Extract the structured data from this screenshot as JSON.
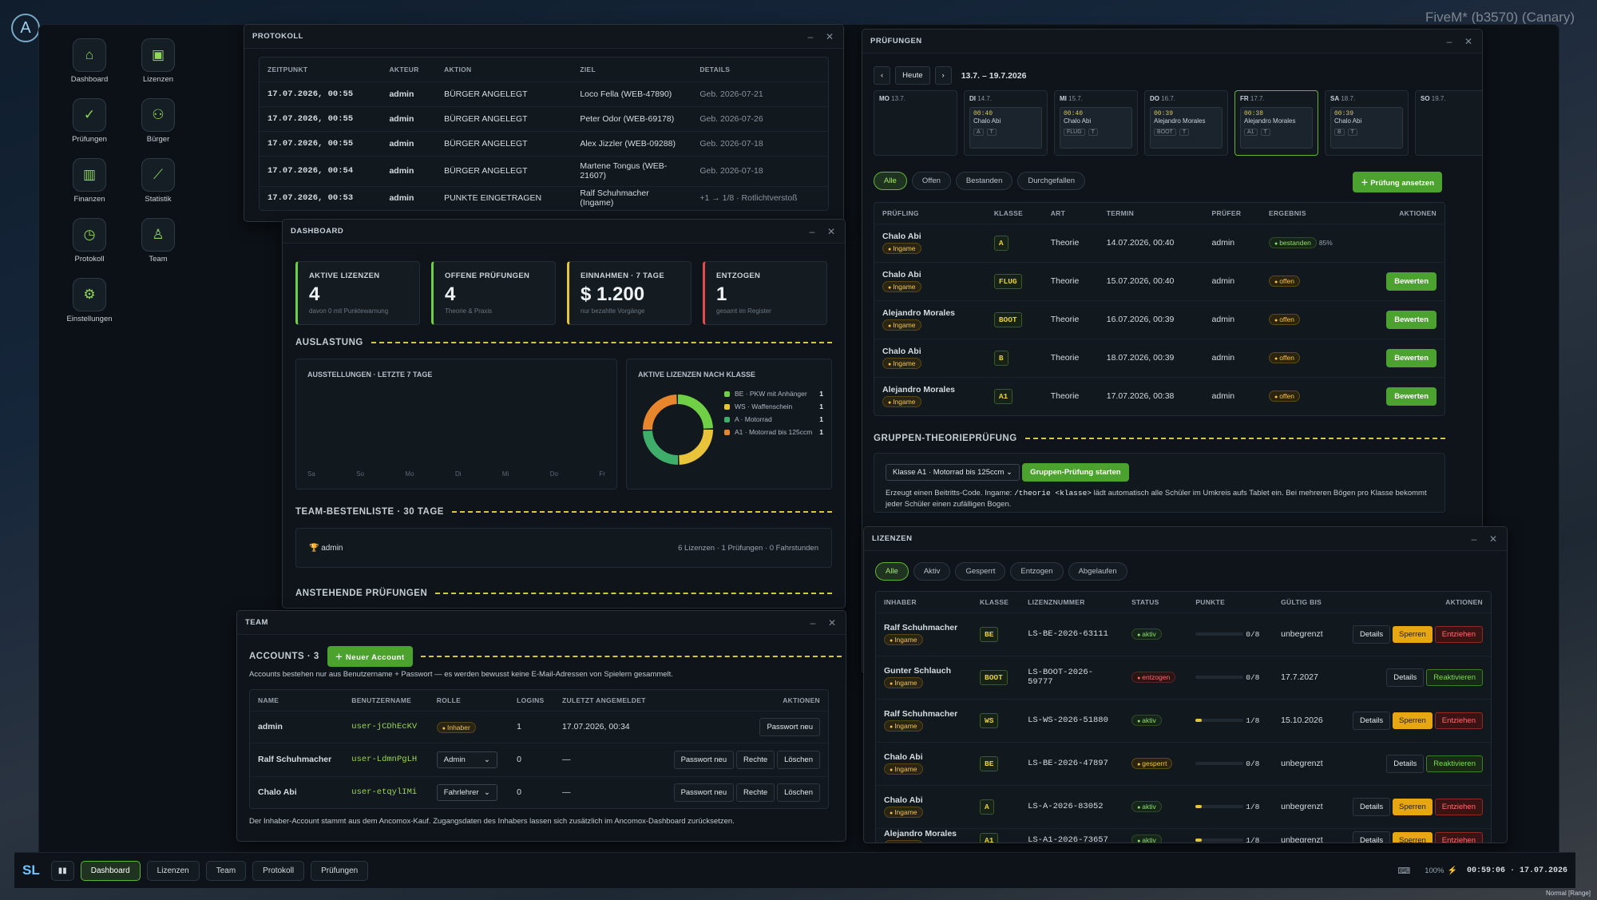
{
  "bg": {
    "server": "FiveM* (b3570) (Canary)"
  },
  "sidebar": {
    "logo": "A",
    "items": [
      {
        "label": "Dashboard",
        "icon": "⌂"
      },
      {
        "label": "Lizenzen",
        "icon": "▣"
      },
      {
        "label": "Prüfungen",
        "icon": "✓"
      },
      {
        "label": "Bürger",
        "icon": "⚇"
      },
      {
        "label": "Finanzen",
        "icon": "▥"
      },
      {
        "label": "Statistik",
        "icon": "⟋"
      },
      {
        "label": "Protokoll",
        "icon": "◷"
      },
      {
        "label": "Team",
        "icon": "♙"
      },
      {
        "label": "Einstellungen",
        "icon": "⚙"
      }
    ]
  },
  "protokoll": {
    "title": "PROTOKOLL",
    "headers": [
      "ZEITPUNKT",
      "AKTEUR",
      "AKTION",
      "ZIEL",
      "DETAILS"
    ],
    "rows": [
      [
        "17.07.2026, 00:55",
        "admin",
        "BÜRGER ANGELEGT",
        "Loco Fella (WEB-47890)",
        "Geb. 2026-07-21"
      ],
      [
        "17.07.2026, 00:55",
        "admin",
        "BÜRGER ANGELEGT",
        "Peter Odor (WEB-69178)",
        "Geb. 2026-07-26"
      ],
      [
        "17.07.2026, 00:55",
        "admin",
        "BÜRGER ANGELEGT",
        "Alex Jizzler (WEB-09288)",
        "Geb. 2026-07-18"
      ],
      [
        "17.07.2026, 00:54",
        "admin",
        "BÜRGER ANGELEGT",
        "Martene Tongus (WEB-21607)",
        "Geb. 2026-07-18"
      ],
      [
        "17.07.2026, 00:53",
        "admin",
        "PUNKTE EINGETRAGEN",
        "Ralf Schuhmacher (Ingame)",
        "+1 → 1/8 · Rotlichtverstoß"
      ]
    ]
  },
  "dashboard": {
    "title": "DASHBOARD",
    "kpis": [
      {
        "label": "AKTIVE LIZENZEN",
        "value": "4",
        "sub": "davon 0 mit Punktewarnung",
        "color": "#6fcf45"
      },
      {
        "label": "OFFENE PRÜFUNGEN",
        "value": "4",
        "sub": "Theorie & Praxis",
        "color": "#6fcf45"
      },
      {
        "label": "EINNAHMEN · 7 TAGE",
        "value": "$ 1.200",
        "sub": "nur bezahlte Vorgänge",
        "color": "#e3c43a"
      },
      {
        "label": "ENTZOGEN",
        "value": "1",
        "sub": "gesamt im Register",
        "color": "#e24b4b"
      }
    ],
    "auslastung": "AUSLASTUNG",
    "ausstellungen_title": "AUSSTELLUNGEN · LETZTE 7 TAGE",
    "days": [
      "Sa",
      "So",
      "Mo",
      "Di",
      "Mi",
      "Do",
      "Fr"
    ],
    "donut_title": "AKTIVE LIZENZEN NACH KLASSE",
    "chart_data": {
      "type": "pie",
      "title": "AKTIVE LIZENZEN NACH KLASSE",
      "categories": [
        "BE · PKW mit Anhänger",
        "WS · Waffenschein",
        "A · Motorrad",
        "A1 · Motorrad bis 125ccm"
      ],
      "values": [
        1,
        1,
        1,
        1
      ],
      "colors": [
        "#6fcf45",
        "#e9c43a",
        "#3fae6a",
        "#e8862e"
      ]
    },
    "bestenliste": "TEAM-BESTENLISTE · 30 TAGE",
    "best_name": "admin",
    "best_icon": "🏆",
    "best_stats": "6 Lizenzen · 1 Prüfungen · 0 Fahrstunden",
    "anstehend": "ANSTEHENDE PRÜFUNGEN"
  },
  "team": {
    "title": "TEAM",
    "accounts": "ACCOUNTS · 3",
    "new_btn": "＋ Neuer Account",
    "note": "Accounts bestehen nur aus Benutzername + Passwort — es werden bewusst keine E-Mail-Adressen von Spielern gesammelt.",
    "headers": [
      "NAME",
      "BENUTZERNAME",
      "ROLLE",
      "LOGINS",
      "ZULETZT ANGEMELDET",
      "AKTIONEN"
    ],
    "rows": [
      {
        "name": "admin",
        "user": "user-jCDhEcKV",
        "role": "Inhaber",
        "logins": "1",
        "last": "17.07.2026, 00:34"
      },
      {
        "name": "Ralf Schuhmacher",
        "user": "user-LdmnPgLH",
        "role": "Admin",
        "logins": "0",
        "last": "—"
      },
      {
        "name": "Chalo Abi",
        "user": "user-etqylIMi",
        "role": "Fahrlehrer",
        "logins": "0",
        "last": "—"
      }
    ],
    "pw": "Passwort neu",
    "rechte": "Rechte",
    "loeschen": "Löschen",
    "footer": "Der Inhaber-Account stammt aus dem Ancomox-Kauf. Zugangsdaten des Inhabers lassen sich zusätzlich im Ancomox-Dashboard zurücksetzen."
  },
  "pruefungen": {
    "title": "PRÜFUNGEN",
    "today": "Heute",
    "range": "13.7. – 19.7.2026",
    "days": [
      {
        "d": "MO",
        "n": "13.7.",
        "ev": null
      },
      {
        "d": "DI",
        "n": "14.7.",
        "ev": {
          "t": "00:40",
          "name": "Chalo Abi",
          "k": "A",
          "a": "T"
        }
      },
      {
        "d": "MI",
        "n": "15.7.",
        "ev": {
          "t": "00:40",
          "name": "Chalo Abi",
          "k": "FLUG",
          "a": "T"
        }
      },
      {
        "d": "DO",
        "n": "16.7.",
        "ev": {
          "t": "00:39",
          "name": "Alejandro Morales",
          "k": "BOOT",
          "a": "T"
        }
      },
      {
        "d": "FR",
        "n": "17.7.",
        "ev": {
          "t": "00:38",
          "name": "Alejandro Morales",
          "k": "A1",
          "a": "T"
        }
      },
      {
        "d": "SA",
        "n": "18.7.",
        "ev": {
          "t": "00:39",
          "name": "Chalo Abi",
          "k": "B",
          "a": "T"
        }
      },
      {
        "d": "SO",
        "n": "19.7.",
        "ev": null
      }
    ],
    "filters": [
      "Alle",
      "Offen",
      "Bestanden",
      "Durchgefallen"
    ],
    "new_btn": "＋ Prüfung ansetzen",
    "headers": [
      "PRÜFLING",
      "KLASSE",
      "ART",
      "TERMIN",
      "PRÜFER",
      "ERGEBNIS",
      "AKTIONEN"
    ],
    "rows": [
      {
        "name": "Chalo Abi",
        "tag": "Ingame",
        "k": "A",
        "art": "Theorie",
        "termin": "14.07.2026, 00:40",
        "pruefer": "admin",
        "res": "bestanden",
        "pct": "85%",
        "btn": ""
      },
      {
        "name": "Chalo Abi",
        "tag": "Ingame",
        "k": "FLUG",
        "art": "Theorie",
        "termin": "15.07.2026, 00:40",
        "pruefer": "admin",
        "res": "offen",
        "pct": "",
        "btn": "Bewerten"
      },
      {
        "name": "Alejandro Morales",
        "tag": "Ingame",
        "k": "BOOT",
        "art": "Theorie",
        "termin": "16.07.2026, 00:39",
        "pruefer": "admin",
        "res": "offen",
        "pct": "",
        "btn": "Bewerten"
      },
      {
        "name": "Chalo Abi",
        "tag": "Ingame",
        "k": "B",
        "art": "Theorie",
        "termin": "18.07.2026, 00:39",
        "pruefer": "admin",
        "res": "offen",
        "pct": "",
        "btn": "Bewerten"
      },
      {
        "name": "Alejandro Morales",
        "tag": "Ingame",
        "k": "A1",
        "art": "Theorie",
        "termin": "17.07.2026, 00:38",
        "pruefer": "admin",
        "res": "offen",
        "pct": "",
        "btn": "Bewerten"
      }
    ],
    "gruppe": "GRUPPEN-THEORIEPRÜFUNG",
    "gruppe_sel": "Klasse A1 · Motorrad bis 125ccm",
    "gruppe_btn": "Gruppen-Prüfung starten",
    "gruppe_note1": "Erzeugt einen Beitritts-Code. Ingame: ",
    "gruppe_code": "/theorie <klasse>",
    "gruppe_note2": " lädt automatisch alle Schüler im Umkreis aufs Tablet ein. Bei mehreren Bögen pro Klasse bekommt jeder Schüler einen zufälligen Bogen."
  },
  "lizenzen": {
    "title": "LIZENZEN",
    "filters": [
      "Alle",
      "Aktiv",
      "Gesperrt",
      "Entzogen",
      "Abgelaufen"
    ],
    "headers": [
      "INHABER",
      "KLASSE",
      "LIZENZNUMMER",
      "STATUS",
      "PUNKTE",
      "GÜLTIG BIS",
      "AKTIONEN"
    ],
    "rows": [
      {
        "name": "Ralf Schuhmacher",
        "tag": "Ingame",
        "k": "BE",
        "nr": "LS-BE-2026-63111",
        "status": "aktiv",
        "pts": "0/8",
        "valid": "unbegrenzt"
      },
      {
        "name": "Gunter Schlauch",
        "tag": "Ingame",
        "k": "BOOT",
        "nr": "LS-BOOT-2026-59777",
        "status": "entzogen",
        "pts": "0/8",
        "valid": "17.7.2027"
      },
      {
        "name": "Ralf Schuhmacher",
        "tag": "Ingame",
        "k": "WS",
        "nr": "LS-WS-2026-51880",
        "status": "aktiv",
        "pts": "1/8",
        "valid": "15.10.2026"
      },
      {
        "name": "Chalo Abi",
        "tag": "Ingame",
        "k": "BE",
        "nr": "LS-BE-2026-47897",
        "status": "gesperrt",
        "pts": "0/8",
        "valid": "unbegrenzt"
      },
      {
        "name": "Chalo Abi",
        "tag": "Ingame",
        "k": "A",
        "nr": "LS-A-2026-83052",
        "status": "aktiv",
        "pts": "1/8",
        "valid": "unbegrenzt"
      },
      {
        "name": "Alejandro Morales",
        "tag": "Ingame",
        "k": "A1",
        "nr": "LS-A1-2026-73657",
        "status": "aktiv",
        "pts": "1/8",
        "valid": "unbegrenzt"
      }
    ],
    "details": "Details",
    "sperren": "Sperren",
    "entziehen": "Entziehen",
    "reaktivieren": "Reaktivieren"
  },
  "taskbar": {
    "tabs": [
      "Dashboard",
      "Lizenzen",
      "Team",
      "Protokoll",
      "Prüfungen"
    ],
    "zoom": "100%",
    "clock": "00:59:06 · 17.07.2026",
    "mode": "Normal [Range]"
  }
}
